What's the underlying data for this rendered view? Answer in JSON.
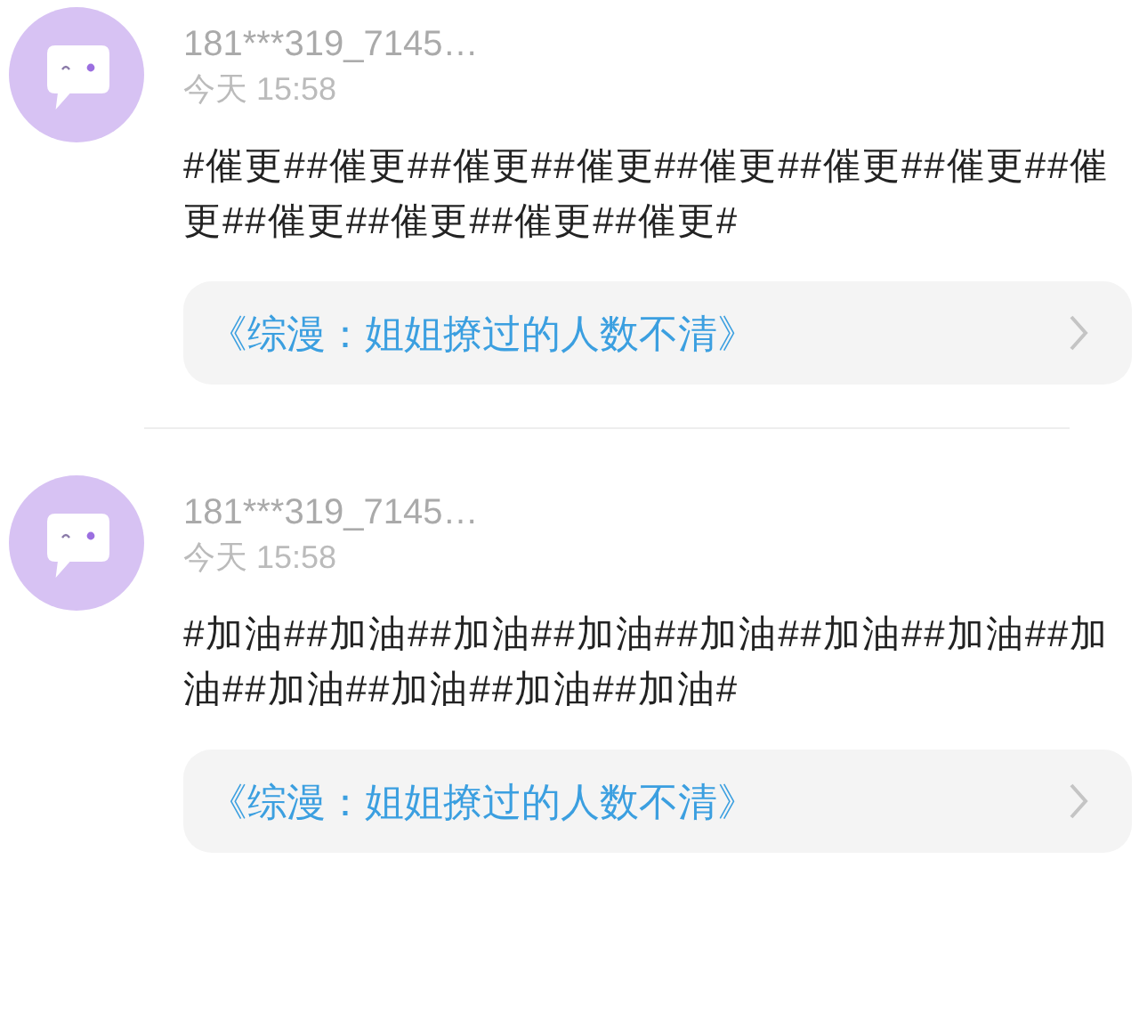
{
  "comments": [
    {
      "username": "181***319_7145…",
      "time": "今天 15:58",
      "content": "#催更##催更##催更##催更##催更##催更##催更##催更##催更##催更##催更##催更#",
      "book_link": "《综漫：姐姐撩过的人数不清》"
    },
    {
      "username": "181***319_7145…",
      "time": "今天 15:58",
      "content": "#加油##加油##加油##加油##加油##加油##加油##加油##加油##加油##加油##加油#",
      "book_link": "《综漫：姐姐撩过的人数不清》"
    }
  ]
}
